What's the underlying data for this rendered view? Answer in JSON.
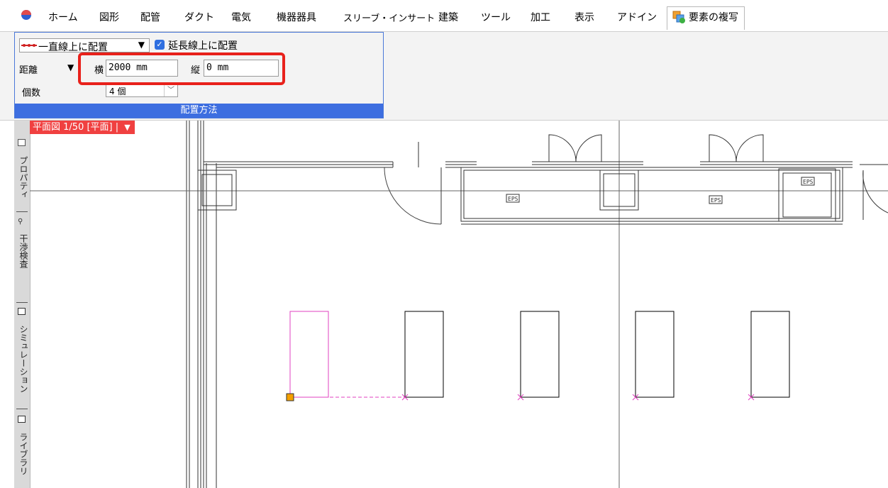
{
  "menu": {
    "items": [
      "ホーム",
      "図形",
      "配管",
      "ダクト",
      "電気",
      "機器器具",
      "スリーブ・インサート",
      "建築",
      "ツール",
      "加工",
      "表示",
      "アドイン"
    ],
    "active_tab": "要素の複写"
  },
  "ribbon": {
    "placement_mode": "一直線上に配置",
    "extend_checkbox_label": "延長線上に配置",
    "extend_checked": true,
    "distance_label": "距離",
    "horizontal_label": "横",
    "horizontal_value": "2000 mm",
    "vertical_label": "縦",
    "vertical_value": "0 mm",
    "count_label": "個数",
    "count_value": "4 個",
    "panel_title": "配置方法"
  },
  "view": {
    "tab_label": "平面図 1/50 [平面] |"
  },
  "sidebar": {
    "items": [
      "プロパティ",
      "干渉検査",
      "シミュレーション",
      "ライブラリ"
    ]
  },
  "drawing": {
    "labels": [
      "EPS",
      "EPS",
      "EPS"
    ]
  },
  "colors": {
    "accent_blue": "#3d6ee0",
    "highlight_red": "#e8211b",
    "view_tab_red": "#f04040",
    "selection_magenta": "#e040c0",
    "handle_orange": "#f5a000"
  }
}
